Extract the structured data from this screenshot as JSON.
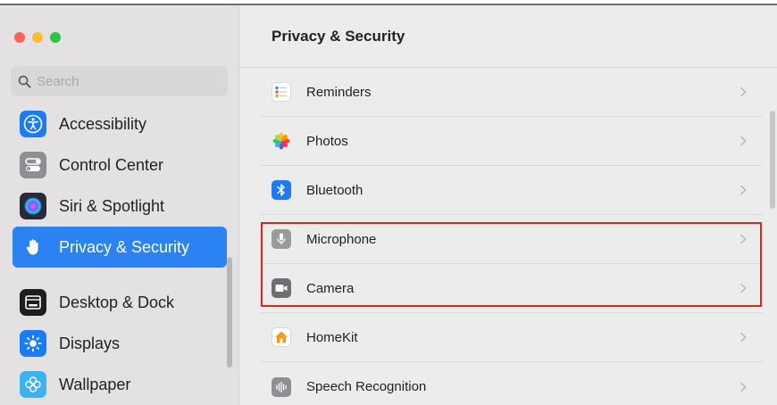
{
  "window": {
    "title": "Privacy & Security"
  },
  "search": {
    "placeholder": "Search",
    "value": ""
  },
  "sidebar": {
    "items": [
      {
        "label": "Accessibility",
        "icon": "accessibility-icon",
        "color": "#1a7cf5"
      },
      {
        "label": "Control Center",
        "icon": "control-center-icon",
        "color": "#8e8e93"
      },
      {
        "label": "Siri & Spotlight",
        "icon": "siri-icon",
        "color": "#2a2a3a"
      },
      {
        "label": "Privacy & Security",
        "icon": "hand-icon",
        "color": "#2b82f2",
        "selected": true
      },
      {
        "label": "Desktop & Dock",
        "icon": "dock-icon",
        "color": "#1e1e1e"
      },
      {
        "label": "Displays",
        "icon": "sun-icon",
        "color": "#1a7cf5"
      },
      {
        "label": "Wallpaper",
        "icon": "wallpaper-icon",
        "color": "#3ab3f0"
      }
    ]
  },
  "main": {
    "rows": [
      {
        "label": "Reminders",
        "icon": "reminders-icon"
      },
      {
        "label": "Photos",
        "icon": "photos-icon"
      },
      {
        "label": "Bluetooth",
        "icon": "bluetooth-icon",
        "color": "#1a7cf5"
      },
      {
        "label": "Microphone",
        "icon": "microphone-icon",
        "color": "#9a9a9a"
      },
      {
        "label": "Camera",
        "icon": "camera-icon",
        "color": "#6e6e73"
      },
      {
        "label": "HomeKit",
        "icon": "home-icon",
        "color": "#f39c12"
      },
      {
        "label": "Speech Recognition",
        "icon": "waveform-icon",
        "color": "#8e8e93"
      }
    ]
  },
  "colors": {
    "accent": "#2b82f2",
    "highlight_box": "#e2231a"
  }
}
